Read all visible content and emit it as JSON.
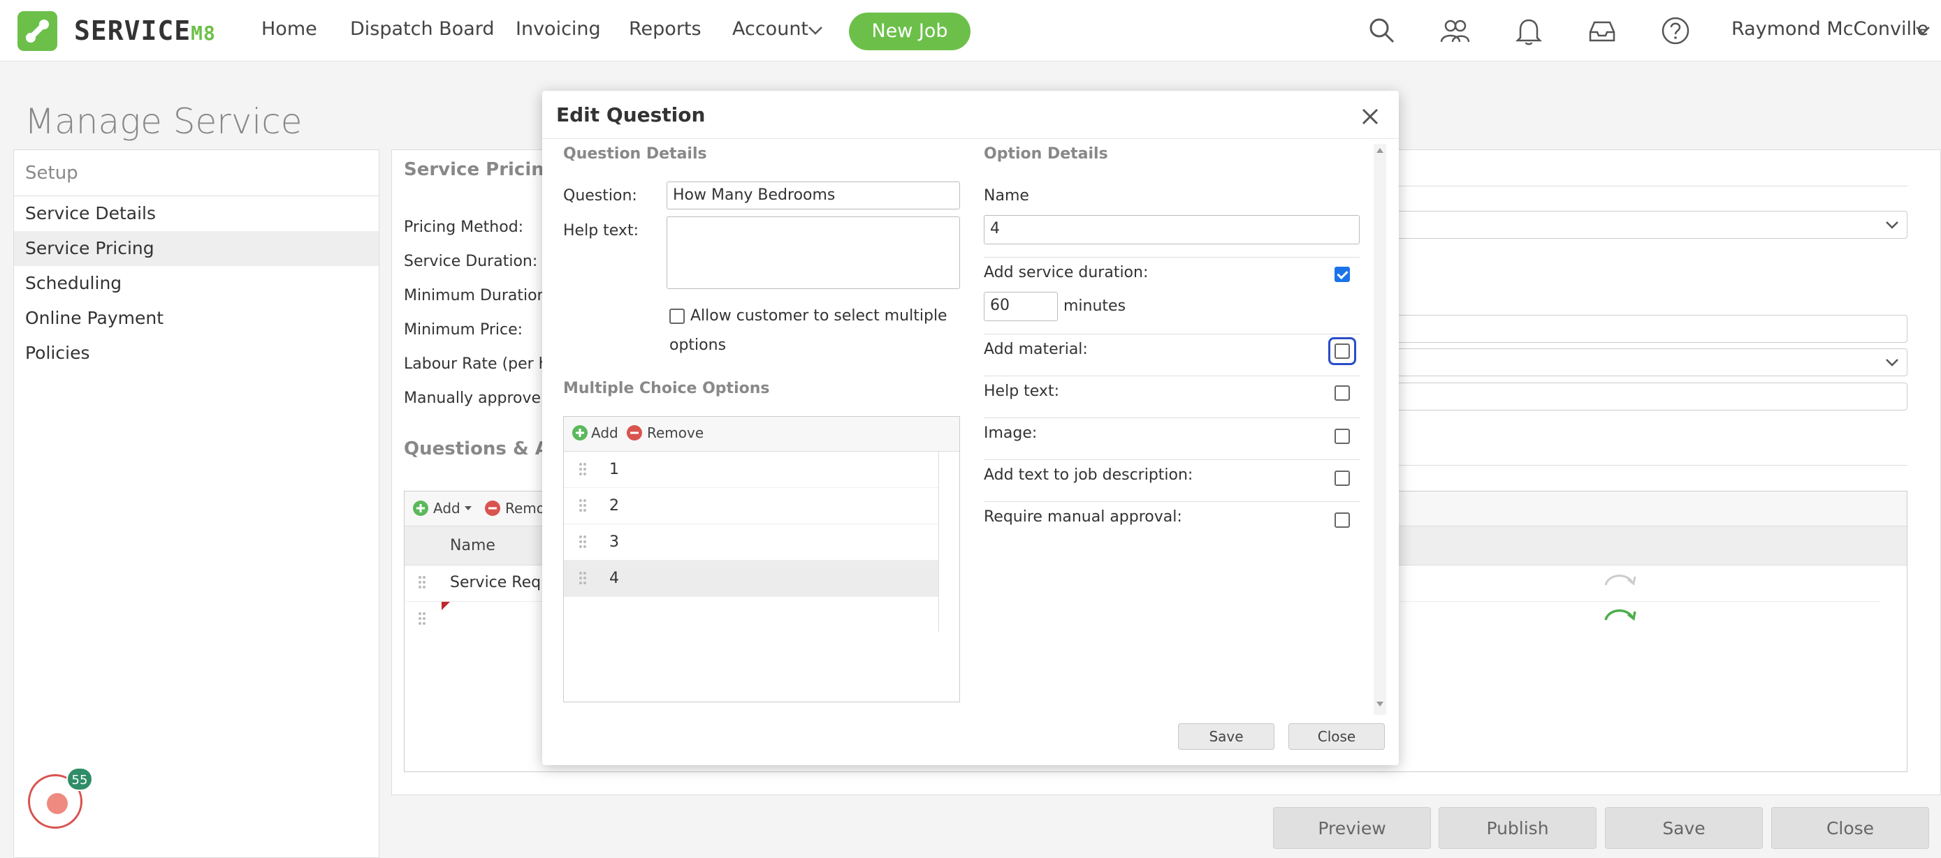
{
  "topnav": {
    "logo_text": "SERVICE",
    "logo_suffix": "M8",
    "home": "Home",
    "dispatch": "Dispatch Board",
    "invoicing": "Invoicing",
    "reports": "Reports",
    "account": "Account",
    "new_job": "New Job",
    "user": "Raymond McConville",
    "brand_color": "#6cc04a"
  },
  "page": {
    "title": "Manage Service",
    "sidebar": {
      "heading": "Setup",
      "items": [
        "Service Details",
        "Service Pricing",
        "Scheduling",
        "Online Payment",
        "Policies"
      ]
    },
    "pricing": {
      "section_title": "Service Pricing",
      "labels": [
        "Pricing Method:",
        "Service Duration:",
        "Minimum Duration:",
        "Minimum Price:",
        "Labour Rate (per hou",
        "Manually approve jo"
      ]
    },
    "questions": {
      "section_title": "Questions & Acti",
      "add": "Add",
      "remove": "Remo",
      "col_name": "Name",
      "row1": "Service Requi"
    },
    "footer": {
      "preview": "Preview",
      "publish": "Publish",
      "save": "Save",
      "close": "Close"
    },
    "badge_count": "55"
  },
  "modal": {
    "title": "Edit Question",
    "question_details": "Question Details",
    "question_label": "Question:",
    "question_value": "How Many Bedrooms",
    "help_label": "Help text:",
    "help_value": "",
    "allow_multiple": "Allow customer to select multiple options",
    "allow_multiple_line1": "Allow customer to select multiple",
    "allow_multiple_line2": "options",
    "mc_title": "Multiple Choice Options",
    "mc_add": "Add",
    "mc_remove": "Remove",
    "options": [
      "1",
      "2",
      "3",
      "4"
    ],
    "option_details": "Option Details",
    "name_label": "Name",
    "name_value": "4",
    "add_duration": "Add service duration:",
    "duration_value": "60",
    "minutes": "minutes",
    "add_material": "Add material:",
    "help_text": "Help text:",
    "image": "Image:",
    "add_text": "Add text to job description:",
    "require_approval": "Require manual approval:",
    "save": "Save",
    "close": "Close"
  }
}
